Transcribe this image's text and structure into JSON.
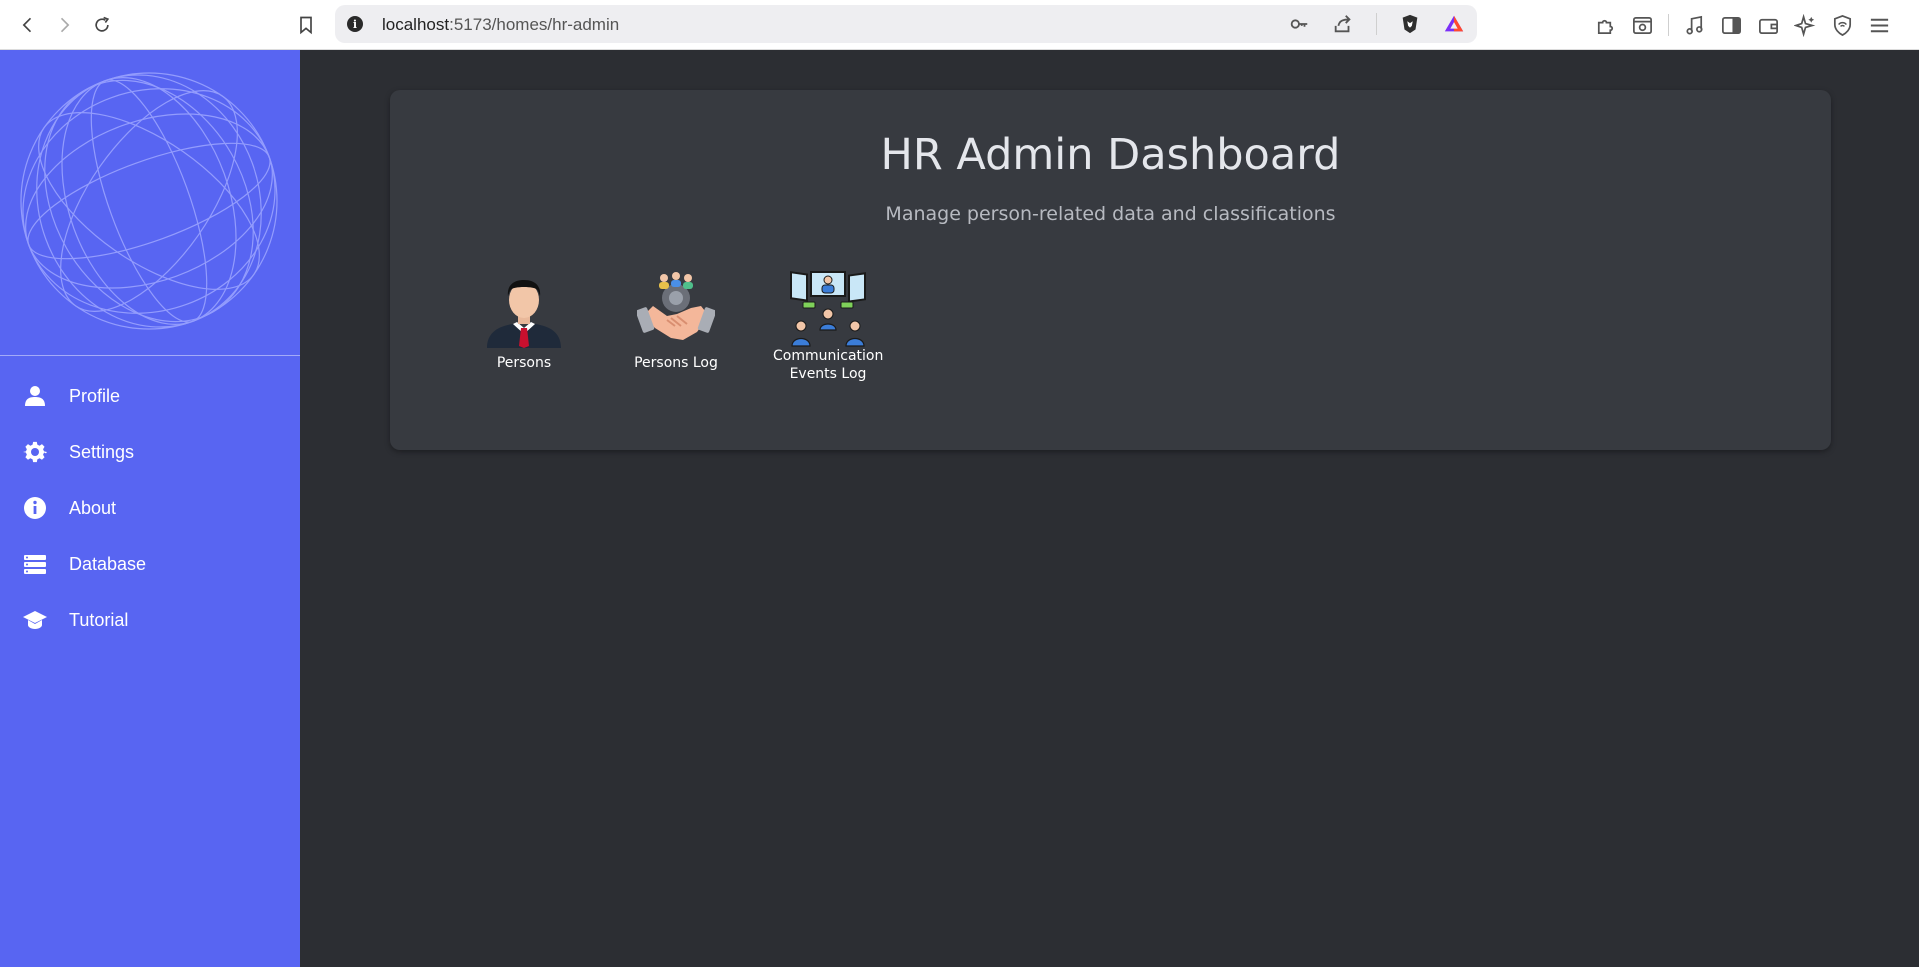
{
  "browser": {
    "url_host": "localhost",
    "url_path": ":5173/homes/hr-admin"
  },
  "sidebar": {
    "items": [
      {
        "label": "Profile",
        "icon": "person-icon"
      },
      {
        "label": "Settings",
        "icon": "gear-icon"
      },
      {
        "label": "About",
        "icon": "info-icon"
      },
      {
        "label": "Database",
        "icon": "database-icon"
      },
      {
        "label": "Tutorial",
        "icon": "graduation-cap-icon"
      }
    ]
  },
  "dashboard": {
    "title": "HR Admin Dashboard",
    "subtitle": "Manage person-related data and classifications",
    "tiles": [
      {
        "label": "Persons",
        "icon": "businessman-icon"
      },
      {
        "label": "Persons Log",
        "icon": "handshake-icon"
      },
      {
        "label": "Communication Events Log",
        "icon": "meeting-icon"
      }
    ]
  },
  "colors": {
    "sidebar_bg": "#5865f2",
    "main_bg": "#2c2e33",
    "card_bg": "#373a40"
  }
}
